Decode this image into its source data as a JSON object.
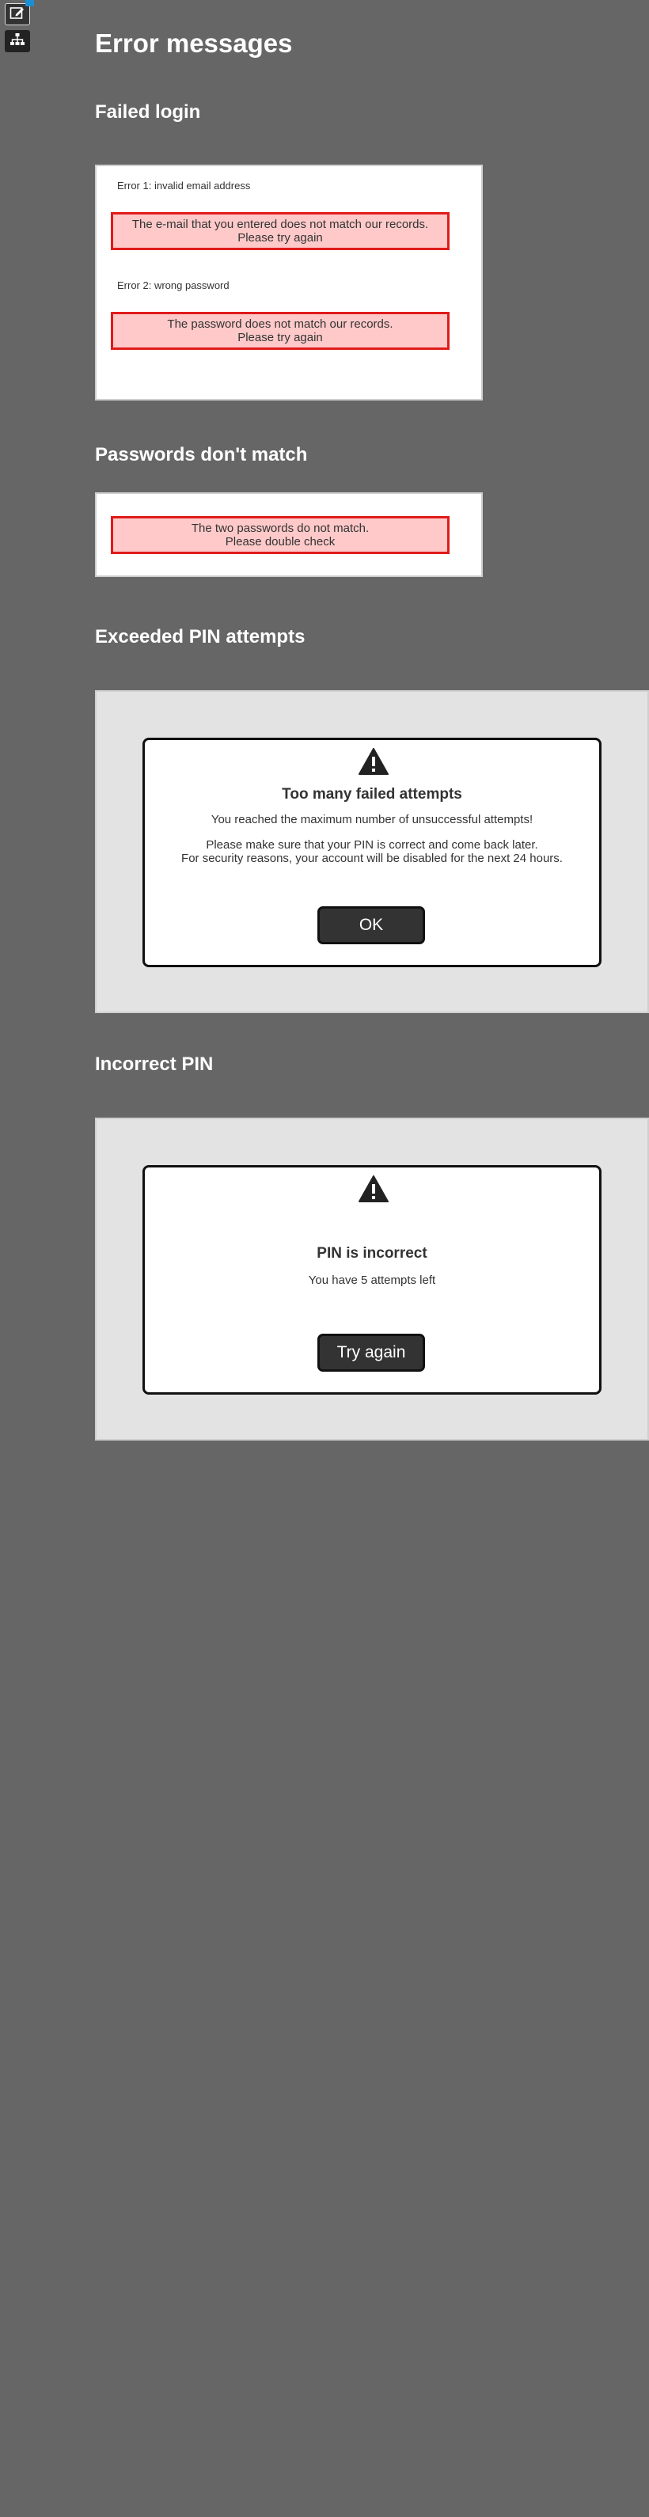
{
  "toolbar": {
    "edit_icon": "edit-icon",
    "sitemap_icon": "sitemap-icon",
    "badge_text": ""
  },
  "page": {
    "title": "Error messages"
  },
  "failed_login": {
    "title": "Failed login",
    "error1_label": "Error 1: invalid email address",
    "error1_line1": "The e-mail that you entered does not match our records.",
    "error1_line2": "Please try again",
    "error2_label": "Error 2: wrong password",
    "error2_line1": "The password does not match our records.",
    "error2_line2": "Please try again"
  },
  "passwords_mismatch": {
    "title": "Passwords don't match",
    "line1": "The two passwords do not match.",
    "line2": "Please double check"
  },
  "exceeded_pin": {
    "title": "Exceeded PIN attempts",
    "dialog_title": "Too many failed attempts",
    "line1": "You reached the maximum number of unsuccessful attempts!",
    "line2": "Please make sure that your PIN is correct and come back later.",
    "line3": "For security reasons, your account will be disabled for the next 24 hours.",
    "button_label": "OK"
  },
  "incorrect_pin": {
    "title": "Incorrect PIN",
    "dialog_title": "PIN is incorrect",
    "line1": "You have 5 attempts left",
    "button_label": "Try again"
  },
  "colors": {
    "background": "#666666",
    "error_fill": "#ffc9c9",
    "error_border": "#e01b1b",
    "button": "#333333"
  }
}
